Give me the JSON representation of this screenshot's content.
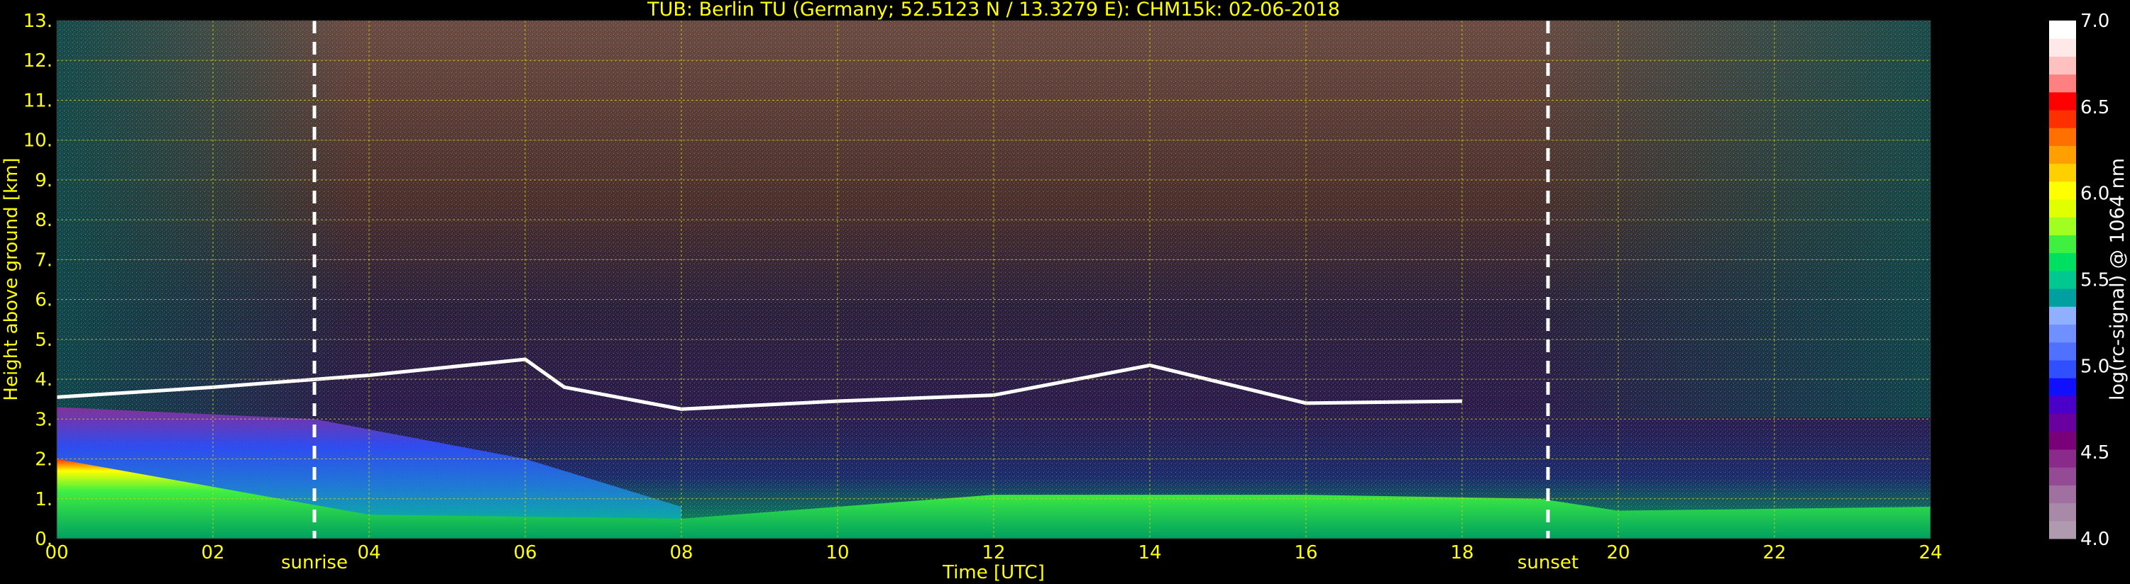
{
  "chart_data": {
    "type": "heatmap",
    "title": "TUB: Berlin TU (Germany; 52.5123 N / 13.3279 E):    CHM15k: 02-06-2018",
    "xlabel": "Time [UTC]",
    "ylabel": "Height above ground [km]",
    "xlim": [
      0,
      24
    ],
    "ylim": [
      0,
      13
    ],
    "x_ticks": [
      "00",
      "02",
      "04",
      "06",
      "08",
      "10",
      "12",
      "14",
      "16",
      "18",
      "20",
      "22",
      "24"
    ],
    "y_ticks": [
      "0.",
      "1.",
      "2.",
      "3.",
      "4.",
      "5.",
      "6.",
      "7.",
      "8.",
      "9.",
      "10.",
      "11.",
      "12.",
      "13."
    ],
    "grid": true,
    "annotations": [
      {
        "label": "sunrise",
        "x": 3.3
      },
      {
        "label": "sunset",
        "x": 19.1
      }
    ],
    "colorbar": {
      "label": "log(rc-signal) @ 1064 nm",
      "range": [
        4.0,
        7.0
      ],
      "ticks": [
        "4.0",
        "4.5",
        "5.0",
        "5.5",
        "6.0",
        "6.5",
        "7.0"
      ],
      "colors": [
        "#b09ab0",
        "#a88aa8",
        "#a070a0",
        "#944a94",
        "#8a2a8a",
        "#7a007a",
        "#6a00a0",
        "#4a00c8",
        "#1010ff",
        "#3050ff",
        "#5070ff",
        "#7090ff",
        "#90b0ff",
        "#00a0a0",
        "#00c890",
        "#00e060",
        "#40f040",
        "#a0ff20",
        "#e0ff00",
        "#ffff00",
        "#ffd000",
        "#ffa000",
        "#ff7000",
        "#ff3000",
        "#ff0000",
        "#ff8080",
        "#ffc0c0",
        "#ffe8e8",
        "#ffffff"
      ]
    },
    "cloud_layer_top_km": [
      {
        "time": 0,
        "height": 3.55
      },
      {
        "time": 2,
        "height": 3.8
      },
      {
        "time": 4,
        "height": 4.1
      },
      {
        "time": 6,
        "height": 4.5
      },
      {
        "time": 6.5,
        "height": 3.8
      },
      {
        "time": 8,
        "height": 3.25
      },
      {
        "time": 10,
        "height": 3.45
      },
      {
        "time": 12,
        "height": 3.6
      },
      {
        "time": 14,
        "height": 4.35
      },
      {
        "time": 16,
        "height": 3.4
      },
      {
        "time": 18,
        "height": 3.45
      }
    ],
    "boundary_layer_top_km": [
      {
        "time": 0,
        "height": 2.0
      },
      {
        "time": 4,
        "height": 0.6
      },
      {
        "time": 8,
        "height": 0.5
      },
      {
        "time": 12,
        "height": 1.1
      },
      {
        "time": 16,
        "height": 1.1
      },
      {
        "time": 19,
        "height": 1.0
      },
      {
        "time": 20,
        "height": 0.7
      },
      {
        "time": 24,
        "height": 0.8
      }
    ]
  }
}
